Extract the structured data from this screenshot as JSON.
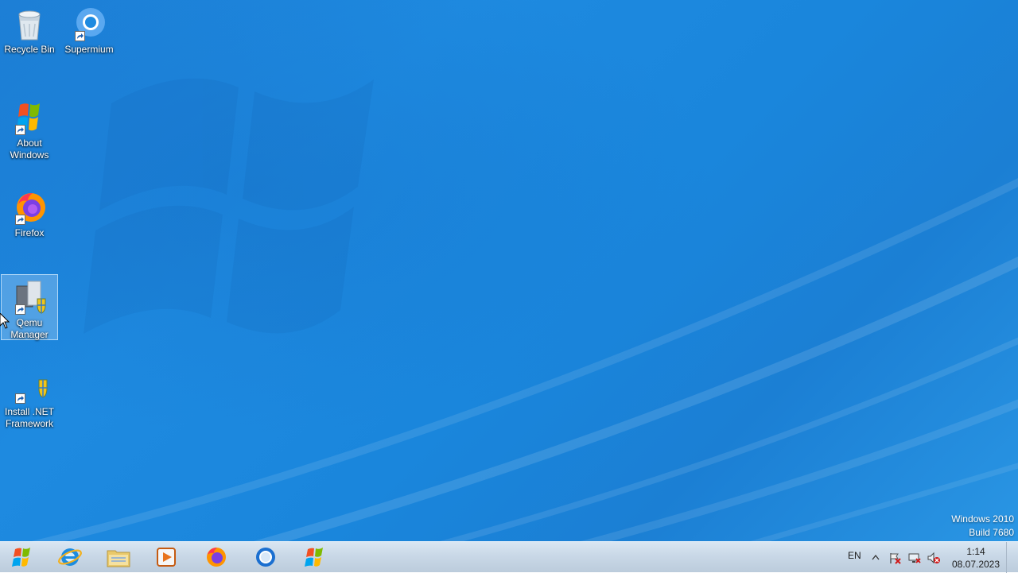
{
  "desktop": {
    "icons": [
      {
        "label": "Recycle Bin",
        "icon": "recycle-bin-icon"
      },
      {
        "label": "Supermium",
        "icon": "supermium-icon"
      },
      {
        "label": "About Windows",
        "icon": "windows-logo-icon"
      },
      {
        "label": "Firefox",
        "icon": "firefox-icon"
      },
      {
        "label": "Qemu Manager",
        "icon": "qemu-manager-icon"
      },
      {
        "label": "Install .NET Framework",
        "icon": "dotnet-installer-icon"
      }
    ],
    "selected_icon": "Qemu Manager"
  },
  "watermark": {
    "line1": "Windows 2010",
    "line2": "Build 7680"
  },
  "taskbar": {
    "start_button": "windows-start-orb-icon",
    "pinned": [
      {
        "icon": "internet-explorer-icon"
      },
      {
        "icon": "file-explorer-icon"
      },
      {
        "icon": "media-player-icon"
      },
      {
        "icon": "firefox-icon"
      },
      {
        "icon": "supermium-icon"
      },
      {
        "icon": "windows-logo-icon"
      }
    ],
    "tray": {
      "language": "EN",
      "icons": [
        "show-hidden-icons-arrow",
        "action-center-flag-icon",
        "network-disconnected-icon",
        "volume-muted-icon"
      ],
      "time": "1:14",
      "date": "08.07.2023"
    }
  },
  "colors": {
    "desktop_blue": "#1e8ae0",
    "taskbar": "#c9d8e7"
  }
}
